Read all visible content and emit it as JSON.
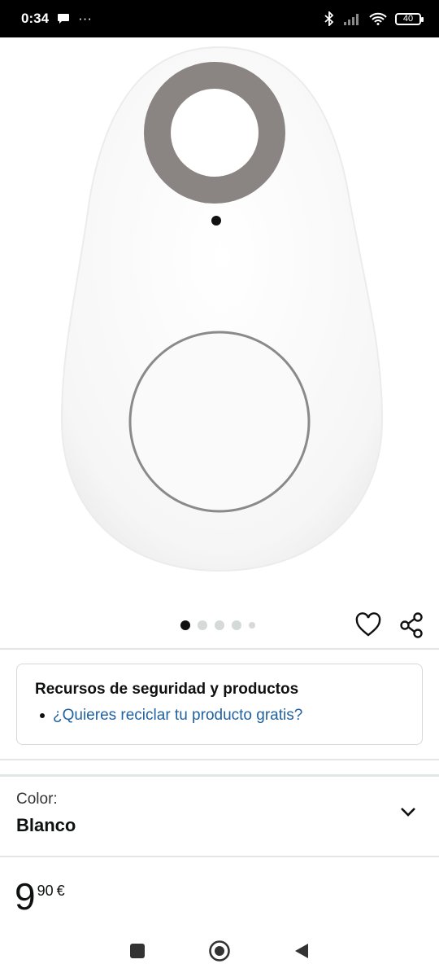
{
  "status_bar": {
    "time": "0:34",
    "more": "···",
    "battery": "40"
  },
  "product": {
    "image_alt_icon": "bluetooth-tracker-tag-image",
    "carousel": {
      "total": 5,
      "active": 1
    }
  },
  "safety": {
    "title": "Recursos de seguridad y productos",
    "link": "¿Quieres reciclar tu producto gratis?"
  },
  "color": {
    "label": "Color:",
    "value": "Blanco"
  },
  "price": {
    "whole": "9",
    "fraction": "90",
    "currency": "€"
  },
  "colors": {
    "link": "#2162a1",
    "text": "#0f1111",
    "divider": "#e3e6e6"
  }
}
